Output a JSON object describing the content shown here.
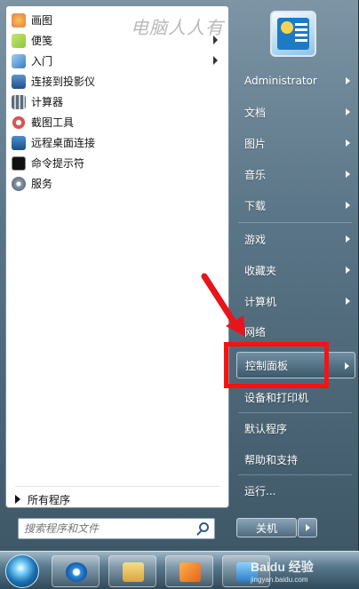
{
  "watermark": "电脑人人有",
  "programs": [
    {
      "label": "画图",
      "icon": "paint-icon",
      "color": "#e87a3c",
      "has_submenu": false
    },
    {
      "label": "便笺",
      "icon": "sticky-notes-icon",
      "color": "#8cc63f",
      "has_submenu": true
    },
    {
      "label": "入门",
      "icon": "getting-started-icon",
      "color": "#5a9bd5",
      "has_submenu": true
    },
    {
      "label": "连接到投影仪",
      "icon": "projector-icon",
      "color": "#3a6ea5",
      "has_submenu": false
    },
    {
      "label": "计算器",
      "icon": "calculator-icon",
      "color": "#7f8c99",
      "has_submenu": false
    },
    {
      "label": "截图工具",
      "icon": "snipping-tool-icon",
      "color": "#d9534f",
      "has_submenu": false
    },
    {
      "label": "远程桌面连接",
      "icon": "remote-desktop-icon",
      "color": "#2f6fb0",
      "has_submenu": false
    },
    {
      "label": "命令提示符",
      "icon": "cmd-icon",
      "color": "#111111",
      "has_submenu": false
    },
    {
      "label": "服务",
      "icon": "services-icon",
      "color": "#8a9aa8",
      "has_submenu": false
    }
  ],
  "all_programs": "所有程序",
  "search": {
    "placeholder": "搜索程序和文件"
  },
  "right_menu": [
    {
      "label": "Administrator",
      "has_submenu": true
    },
    {
      "label": "文档",
      "has_submenu": true
    },
    {
      "label": "图片",
      "has_submenu": true
    },
    {
      "label": "音乐",
      "has_submenu": true
    },
    {
      "label": "下载",
      "has_submenu": true
    },
    {
      "label": "游戏",
      "has_submenu": true
    },
    {
      "label": "收藏夹",
      "has_submenu": true
    },
    {
      "label": "计算机",
      "has_submenu": true
    },
    {
      "label": "网络",
      "has_submenu": false
    },
    {
      "label": "控制面板",
      "has_submenu": true,
      "active": true
    },
    {
      "label": "设备和打印机",
      "has_submenu": false
    },
    {
      "label": "默认程序",
      "has_submenu": false
    },
    {
      "label": "帮助和支持",
      "has_submenu": false
    },
    {
      "label": "运行...",
      "has_submenu": false
    }
  ],
  "shutdown_label": "关机",
  "taskbar": {
    "watermark": "Baidu 经验",
    "watermark_sub": "jingyan.baidu.com",
    "buttons": [
      "internet-explorer-icon",
      "file-explorer-icon",
      "media-player-icon",
      "control-panel-icon"
    ]
  },
  "colors": {
    "highlight": "#ff1010",
    "arrow": "#e8141c"
  }
}
